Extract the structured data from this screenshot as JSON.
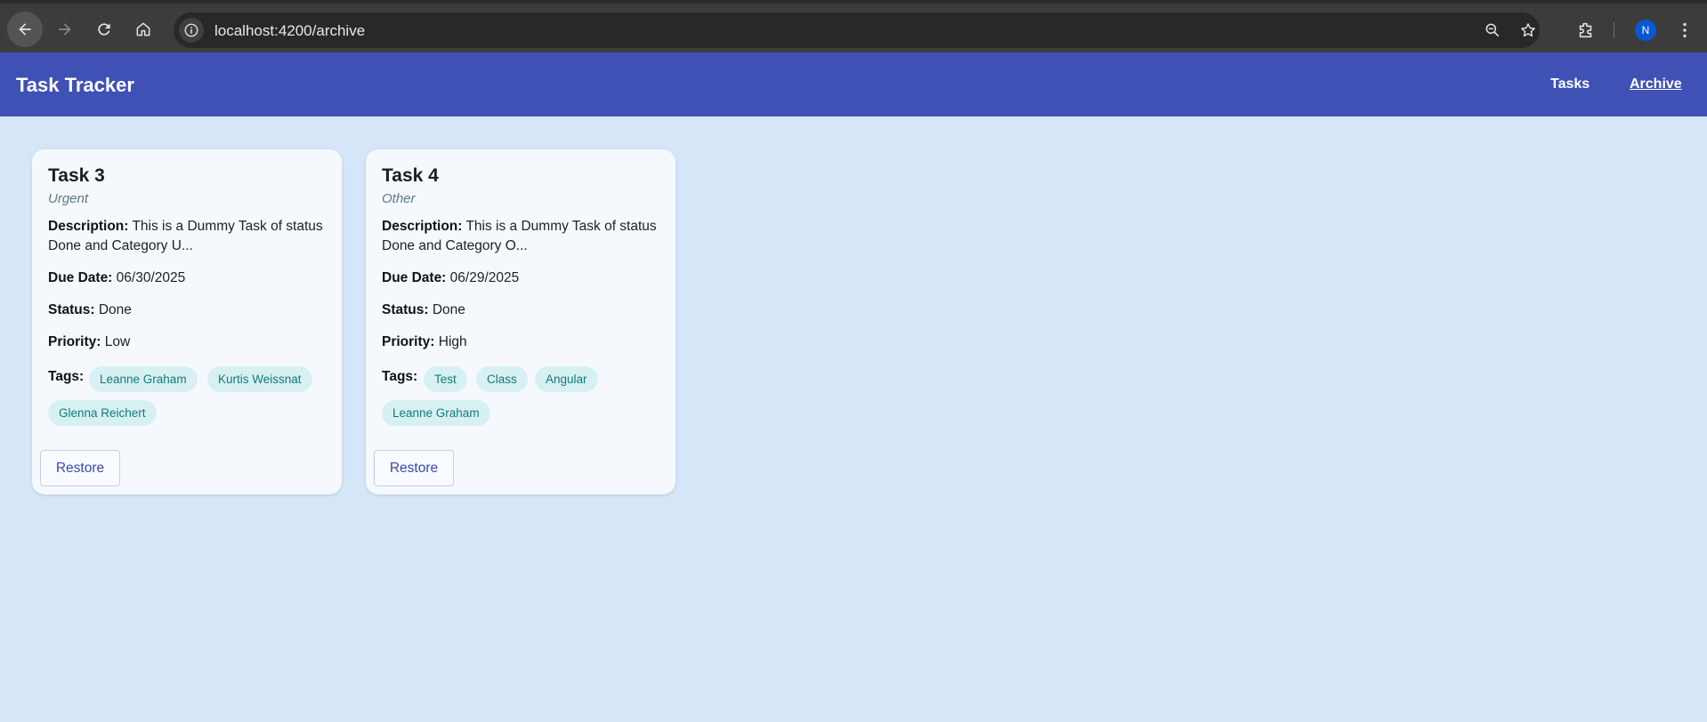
{
  "browser": {
    "url": "localhost:4200/archive",
    "profile_initial": "N",
    "icons": [
      "back-arrow-icon",
      "forward-arrow-icon",
      "reload-icon",
      "home-icon",
      "info-icon",
      "zoom-out-icon",
      "star-icon",
      "extensions-icon",
      "more-vert-icon"
    ]
  },
  "app": {
    "title": "Task Tracker",
    "nav": {
      "tasks": "Tasks",
      "archive": "Archive"
    },
    "colors": {
      "toolbar": "#3f51b5",
      "background": "#d4e6f7",
      "chip_bg": "#d7f1f3",
      "chip_text": "#127a78"
    }
  },
  "cards": [
    {
      "title": "Task 3",
      "category": "Urgent",
      "labels": {
        "description": "Description:",
        "due": "Due Date:",
        "status": "Status:",
        "priority": "Priority:",
        "tags": "Tags:"
      },
      "description": "This is a Dummy Task of status Done and Category U...",
      "due_date": "06/30/2025",
      "status": "Done",
      "priority": "Low",
      "tags": [
        "Leanne Graham",
        "Kurtis Weissnat",
        "Glenna Reichert"
      ],
      "action": "Restore"
    },
    {
      "title": "Task 4",
      "category": "Other",
      "labels": {
        "description": "Description:",
        "due": "Due Date:",
        "status": "Status:",
        "priority": "Priority:",
        "tags": "Tags:"
      },
      "description": "This is a Dummy Task of status Done and Category O...",
      "due_date": "06/29/2025",
      "status": "Done",
      "priority": "High",
      "tags": [
        "Test",
        "Class",
        "Angular",
        "Leanne Graham"
      ],
      "action": "Restore"
    }
  ]
}
